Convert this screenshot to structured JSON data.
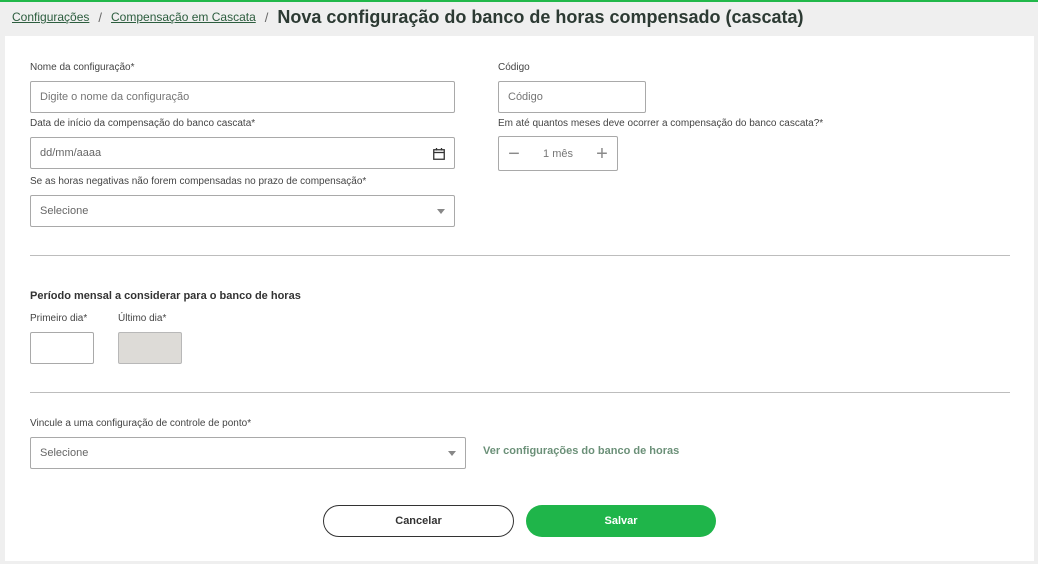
{
  "breadcrumb": {
    "items": [
      "Configurações",
      "Compensação em Cascata"
    ],
    "separator": "/",
    "title": "Nova configuração do banco de horas compensado (cascata)"
  },
  "form": {
    "name": {
      "label": "Nome da configuração*",
      "placeholder": "Digite o nome da configuração",
      "value": ""
    },
    "code": {
      "label": "Código",
      "placeholder": "Código",
      "value": ""
    },
    "start_date": {
      "label": "Data de início da compensação do banco cascata*",
      "placeholder": "dd/mm/aaaa",
      "icon": "calendar-icon"
    },
    "months": {
      "label": "Em até quantos meses deve ocorrer a compensação do banco cascata?*",
      "value": "1 mês",
      "minus": "−",
      "plus": "+"
    },
    "negative_hours": {
      "label": "Se as horas negativas não forem compensadas no prazo de compensação*",
      "value": "Selecione"
    },
    "period": {
      "title": "Período mensal a considerar para o banco de horas",
      "first_day_label": "Primeiro dia*",
      "last_day_label": "Último dia*",
      "first_day_value": "",
      "last_day_value": ""
    },
    "link_config": {
      "label": "Vincule a uma configuração de controle de ponto*",
      "value": "Selecione",
      "link_text": "Ver configurações do banco de horas"
    }
  },
  "actions": {
    "cancel": "Cancelar",
    "save": "Salvar"
  },
  "colors": {
    "accent": "#1fb54a",
    "top_border": "#21b84a",
    "disabled_field": "#dddbd7",
    "link": "#6b9078"
  }
}
